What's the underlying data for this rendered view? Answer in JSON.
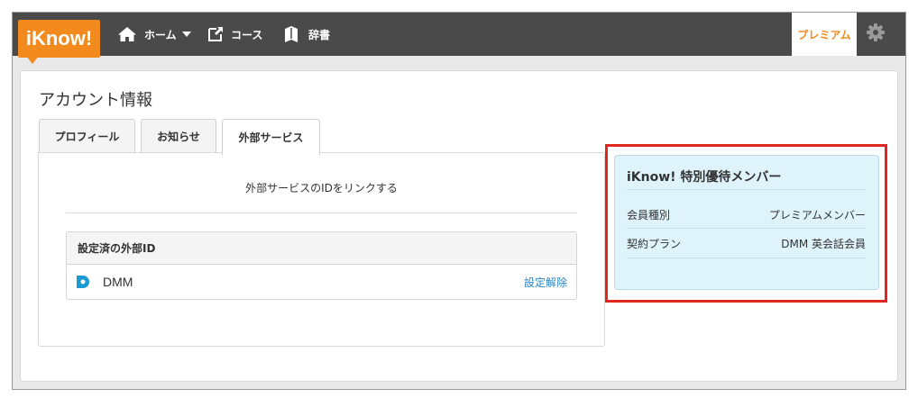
{
  "navbar": {
    "logo_text": "iKnow!",
    "items": [
      {
        "label": "ホーム",
        "icon": "home-icon"
      },
      {
        "label": "コース",
        "icon": "course-icon"
      },
      {
        "label": "辞書",
        "icon": "dictionary-icon"
      }
    ],
    "premium_label": "プレミアム",
    "settings_icon": "gear-icon"
  },
  "page": {
    "title": "アカウント情報",
    "tabs": [
      {
        "label": "プロフィール"
      },
      {
        "label": "お知らせ"
      },
      {
        "label": "外部サービス",
        "active": true
      }
    ],
    "external": {
      "description": "外部サービスのIDをリンクする",
      "linked_header": "設定済の外部ID",
      "services": [
        {
          "name": "DMM",
          "action_label": "設定解除",
          "icon": "dmm-icon"
        }
      ]
    }
  },
  "membership": {
    "title": "iKnow! 特別優待メンバー",
    "rows": [
      {
        "label": "会員種別",
        "value": "プレミアムメンバー"
      },
      {
        "label": "契約プラン",
        "value": "DMM 英会話会員"
      }
    ]
  },
  "colors": {
    "brand": "#f28a1d",
    "navbar": "#4a4a4a",
    "link": "#2a86c7",
    "highlight": "#e0261f",
    "member_bg": "#dff3fb"
  }
}
